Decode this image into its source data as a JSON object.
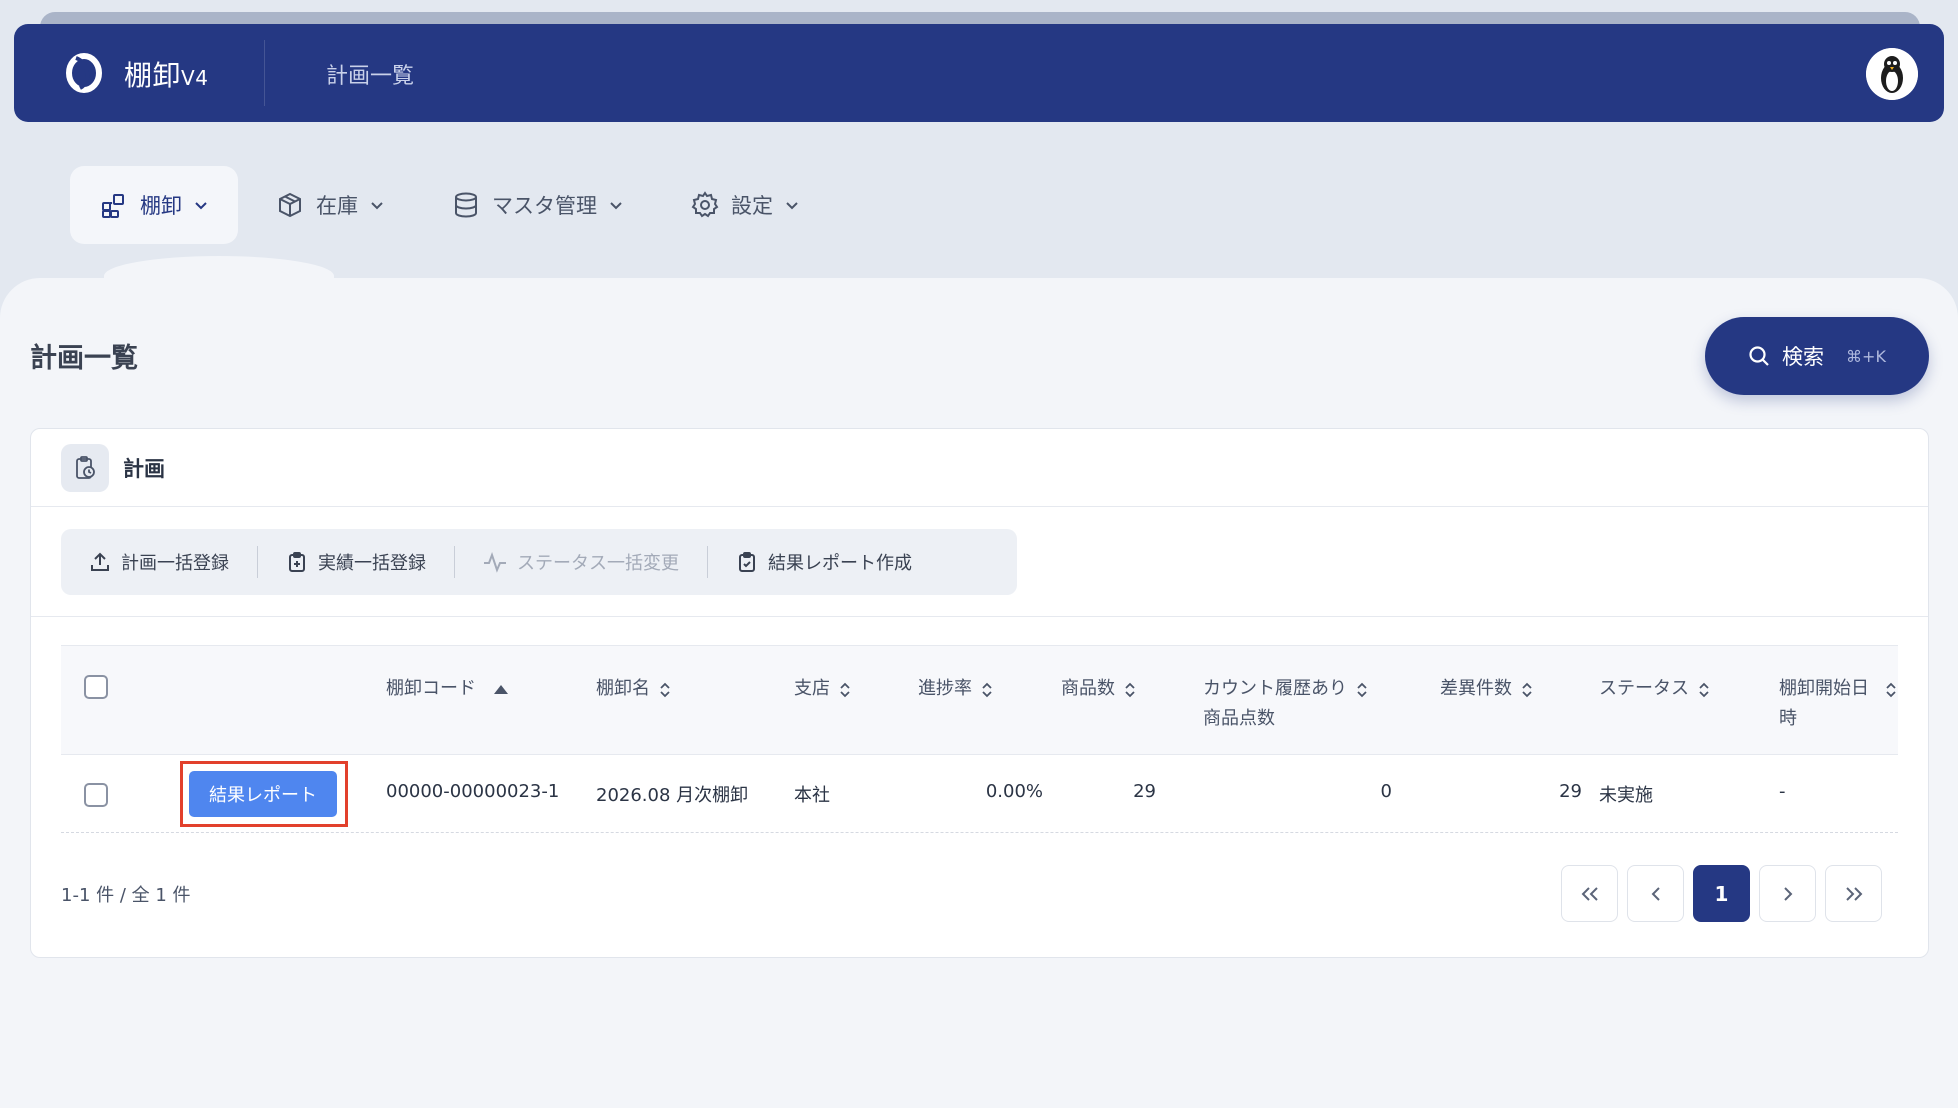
{
  "header": {
    "brand": "棚卸",
    "version": "V4",
    "breadcrumb": "計画一覧"
  },
  "nav": [
    {
      "label": "棚卸",
      "icon": "grid-icon",
      "active": true
    },
    {
      "label": "在庫",
      "icon": "box-icon",
      "active": false
    },
    {
      "label": "マスタ管理",
      "icon": "database-icon",
      "active": false
    },
    {
      "label": "設定",
      "icon": "gear-icon",
      "active": false
    }
  ],
  "page": {
    "title": "計画一覧",
    "search_label": "検索",
    "search_shortcut": "⌘+K"
  },
  "card": {
    "title": "計画",
    "toolbar": [
      {
        "label": "計画一括登録",
        "icon": "upload-icon",
        "enabled": true
      },
      {
        "label": "実績一括登録",
        "icon": "clipboard-plus-icon",
        "enabled": true
      },
      {
        "label": "ステータス一括変更",
        "icon": "activity-icon",
        "enabled": false
      },
      {
        "label": "結果レポート作成",
        "icon": "clipboard-check-icon",
        "enabled": true
      }
    ]
  },
  "table": {
    "columns": {
      "code": "棚卸コード",
      "name": "棚卸名",
      "branch": "支店",
      "progress": "進捗率",
      "item_count": "商品数",
      "counted_line1": "カウント履歴あり",
      "counted_line2": "商品点数",
      "diff_count": "差異件数",
      "status": "ステータス",
      "start_date": "棚卸開始日時"
    },
    "rows": [
      {
        "action": "結果レポート",
        "code": "00000-00000023-1",
        "name": "2026.08 月次棚卸",
        "branch": "本社",
        "progress": "0.00%",
        "item_count": "29",
        "counted": "0",
        "diff_count": "29",
        "status": "未実施",
        "start_date": "-"
      }
    ]
  },
  "pagination": {
    "summary": "1-1 件 / 全 1 件",
    "first": "«",
    "prev": "‹",
    "current": "1",
    "next": "›",
    "last": "»"
  },
  "colors": {
    "primary": "#253883",
    "accent_button": "#4f86ef",
    "highlight": "#e2402c"
  }
}
